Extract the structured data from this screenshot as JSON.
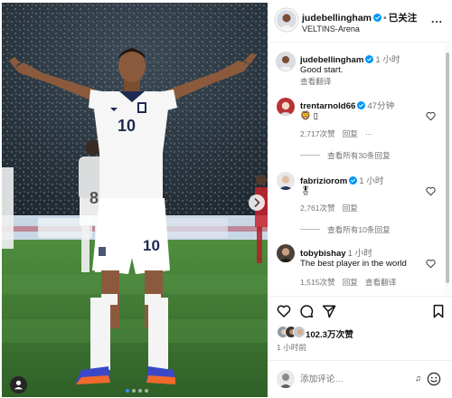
{
  "post": {
    "author": "judebellingham",
    "follow_label": "已关注",
    "location": "VELTINS-Arena",
    "more_label": "...",
    "image_player_number": "10",
    "image_number_upper": "10",
    "image_background_player_number": "8",
    "carousel_count": 4,
    "carousel_active_index": 0,
    "likes": "102.3万次赞",
    "posted": "1 小时前",
    "add_comment_placeholder": "添加评论…",
    "gif_label": "♫"
  },
  "caption": {
    "user": "judebellingham",
    "time": "1 小时",
    "text": "Good start.",
    "translate": "查看翻译"
  },
  "comments": [
    {
      "user": "trentarnold66",
      "verified": true,
      "time": "47分钟",
      "text": "🦁 ▯",
      "likes": "2,717次赞",
      "reply": "回复",
      "options": "···",
      "view_replies": "查看所有30条回复"
    },
    {
      "user": "fabriziorom",
      "verified": true,
      "time": "1 小时",
      "text": "🎖",
      "likes": "2,761次赞",
      "reply": "回复",
      "view_replies": "查看所有10条回复"
    },
    {
      "user": "tobybishay",
      "verified": false,
      "time": "1 小时",
      "text": "The best player in the world",
      "likes": "1,515次赞",
      "reply": "回复",
      "translate": "查看翻译"
    }
  ],
  "icons": {
    "verified": "verified-badge-icon",
    "like": "heart-icon",
    "comment": "comment-icon",
    "share": "send-icon",
    "save": "bookmark-icon",
    "tag": "user-tag-icon",
    "next": "chevron-right-icon",
    "emoji": "smiley-icon"
  },
  "colors": {
    "verified_blue": "#0095f6",
    "secondary_text": "#737373",
    "pitch_green": "#3f7a33",
    "england_white": "#f4f4f4",
    "boot_orange": "#f06a2c"
  }
}
